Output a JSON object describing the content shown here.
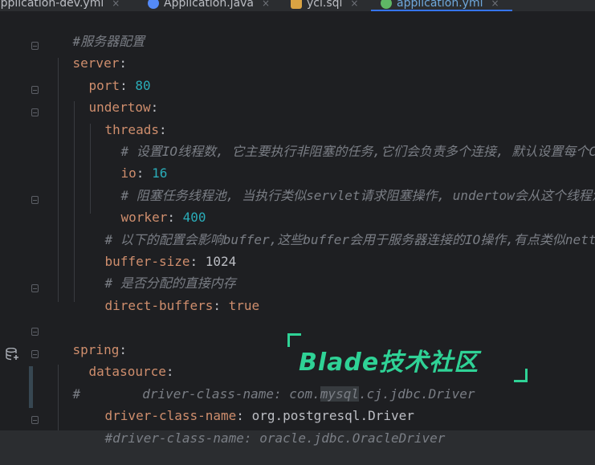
{
  "tabs": [
    {
      "label": "application-dev.yml",
      "icon": "yaml-icon",
      "active": false
    },
    {
      "label": "Application.java",
      "icon": "java-class-icon",
      "active": false
    },
    {
      "label": "ycl.sql",
      "icon": "sql-file-icon",
      "active": false
    },
    {
      "label": "application.yml",
      "icon": "yaml-icon",
      "active": true
    }
  ],
  "tab_close": "×",
  "code": {
    "l1_comment": "#服务器配置",
    "l2_key": "server",
    "l3_key": "port",
    "l3_val": "80",
    "l4_key": "undertow",
    "l5_key": "threads",
    "l6_comment": "# 设置IO线程数, 它主要执行非阻塞的任务,它们会负责多个连接, 默认设置每个CPU核",
    "l7_key": "io",
    "l7_val": "16",
    "l8_comment": "# 阻塞任务线程池, 当执行类似servlet请求阻塞操作, undertow会从这个线程池中",
    "l9_key": "worker",
    "l9_val": "400",
    "l10_comment": "# 以下的配置会影响buffer,这些buffer会用于服务器连接的IO操作,有点类似netty的",
    "l11_key": "buffer-size",
    "l11_val": "1024",
    "l12_comment": "# 是否分配的直接内存",
    "l13_key": "direct-buffers",
    "l13_val": "true",
    "l15_key": "spring",
    "l16_key": "datasource",
    "l17_hash": "#",
    "l17_pre": "    driver-class-name: com.",
    "l17_hl": "mysql",
    "l17_post": ".cj.jdbc.Driver",
    "l18_key": "driver-class-name",
    "l18_v1": "org",
    "l18_v2": "postgresql",
    "l18_v3": "Driver",
    "l19_comment": "#driver-class-name: oracle.jdbc.OracleDriver"
  },
  "watermark": "Blade技术社区",
  "colors": {
    "accent": "#3574f0",
    "watermark": "#2fd296",
    "keyword": "#cf8e6d",
    "number": "#2aacb8",
    "comment": "#7a7e85"
  }
}
